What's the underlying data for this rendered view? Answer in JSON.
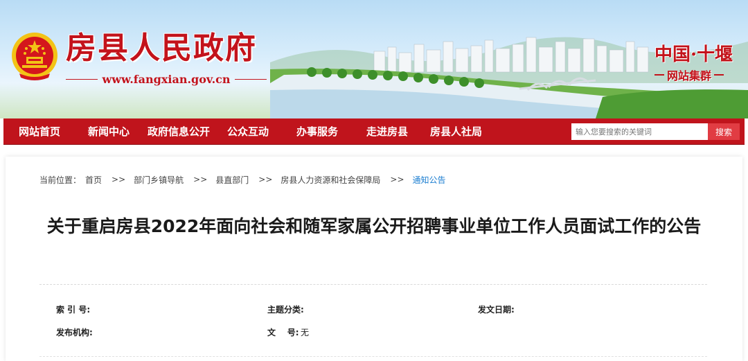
{
  "header": {
    "site_title": "房县人民政府",
    "site_url": "www.fangxian.gov.cn",
    "brand_main": "中国·十堰",
    "brand_sub": "网站集群",
    "emblem_icon": "national-emblem-icon",
    "accent_color": "#c3131b"
  },
  "nav": {
    "items": [
      {
        "label": "网站首页"
      },
      {
        "label": "新闻中心"
      },
      {
        "label": "政府信息公开"
      },
      {
        "label": "公众互动"
      },
      {
        "label": "办事服务"
      },
      {
        "label": "走进房县"
      },
      {
        "label": "房县人社局"
      }
    ],
    "search_placeholder": "输入您要搜索的关键词",
    "search_button": "搜索",
    "bar_color": "#c0141c"
  },
  "breadcrumb": {
    "prefix": "当前位置：",
    "items": [
      "首页",
      "部门乡镇导航",
      "县直部门",
      "房县人力资源和社会保障局",
      "通知公告"
    ],
    "separator": ">>"
  },
  "article": {
    "title": "关于重启房县2022年面向社会和随军家属公开招聘事业单位工作人员面试工作的公告"
  },
  "meta": {
    "index_no_label": "索 引 号:",
    "index_no_value": "",
    "topic_label": "主题分类:",
    "topic_value": "",
    "issue_date_label": "发文日期:",
    "issue_date_value": "",
    "issuer_label": "发布机构:",
    "issuer_value": "",
    "doc_no_label": "文    号:",
    "doc_no_value": "无"
  }
}
